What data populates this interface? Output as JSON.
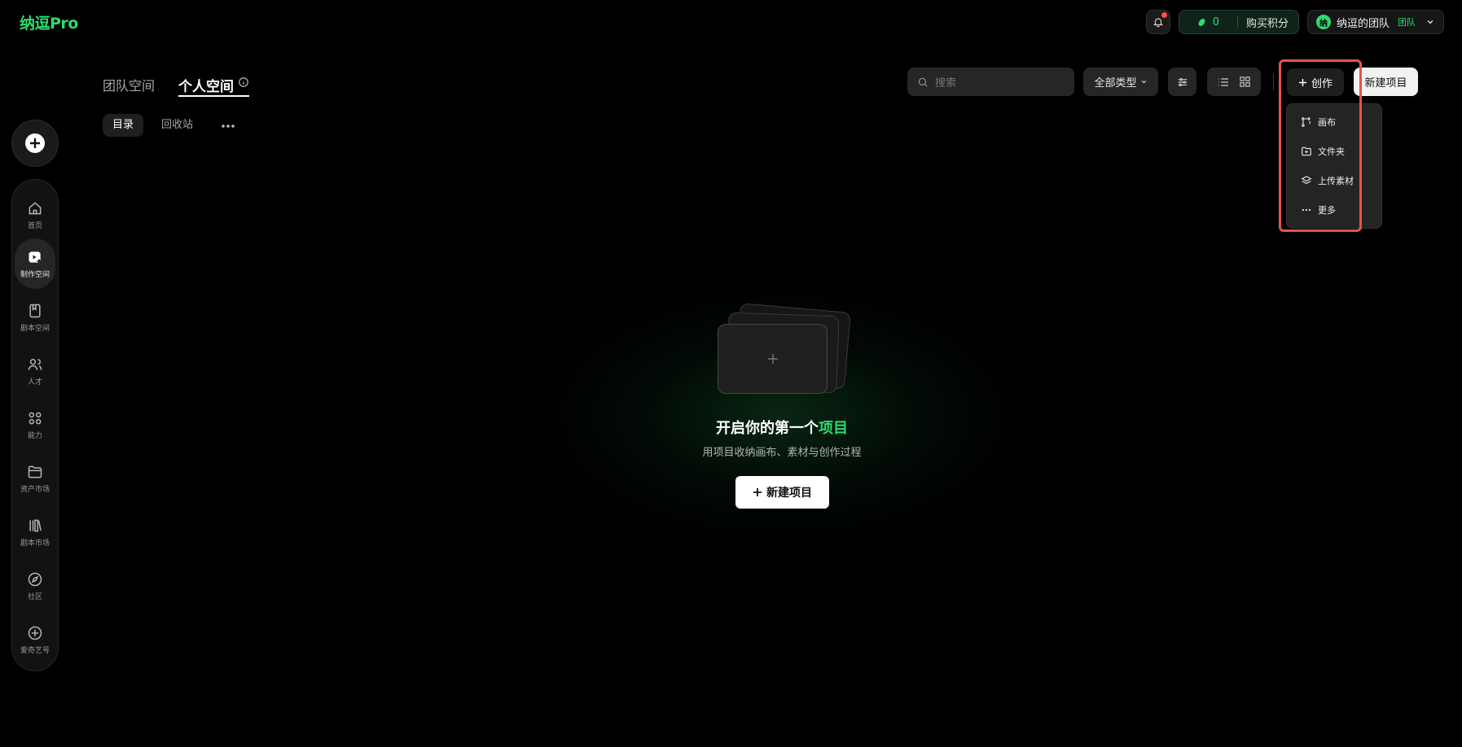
{
  "app": {
    "logo": "纳逗Pro",
    "accent": "#2bdc70"
  },
  "topbar": {
    "bell_icon": "bell-icon",
    "credits": {
      "value": "0",
      "buy_label": "购买积分"
    },
    "team": {
      "avatar_text": "纳",
      "name": "纳逗的团队",
      "tag": "团队"
    }
  },
  "rail": {
    "create_icon": "plus-circle-icon",
    "items": [
      {
        "label": "首页",
        "icon": "home-icon"
      },
      {
        "label": "制作空间",
        "icon": "production-icon",
        "active": true
      },
      {
        "label": "剧本空间",
        "icon": "script-icon"
      },
      {
        "label": "人才",
        "icon": "people-icon"
      },
      {
        "label": "能力",
        "icon": "grid-icon"
      },
      {
        "label": "资产市场",
        "icon": "folder-icon"
      },
      {
        "label": "剧本市场",
        "icon": "books-icon"
      },
      {
        "label": "社区",
        "icon": "compass-icon"
      },
      {
        "label": "爱奇艺号",
        "icon": "plus-circle-outline-icon"
      }
    ]
  },
  "tabs": [
    {
      "label": "团队空间"
    },
    {
      "label": "个人空间",
      "active": true
    }
  ],
  "subtabs": [
    {
      "label": "目录",
      "active": true
    },
    {
      "label": "回收站"
    }
  ],
  "toolbar": {
    "search_placeholder": "搜索",
    "type_filter": "全部类型",
    "create_label": "创作",
    "new_project_label": "新建项目"
  },
  "create_menu": [
    {
      "label": "画布",
      "icon": "canvas-icon"
    },
    {
      "label": "文件夹",
      "icon": "folder-plus-icon"
    },
    {
      "label": "上传素材",
      "icon": "layers-icon"
    },
    {
      "label": "更多",
      "icon": "more-icon"
    }
  ],
  "empty_state": {
    "title_prefix": "开启你的第一个",
    "title_highlight": "项目",
    "subtitle": "用项目收纳画布、素材与创作过程",
    "button_label": "新建项目"
  }
}
